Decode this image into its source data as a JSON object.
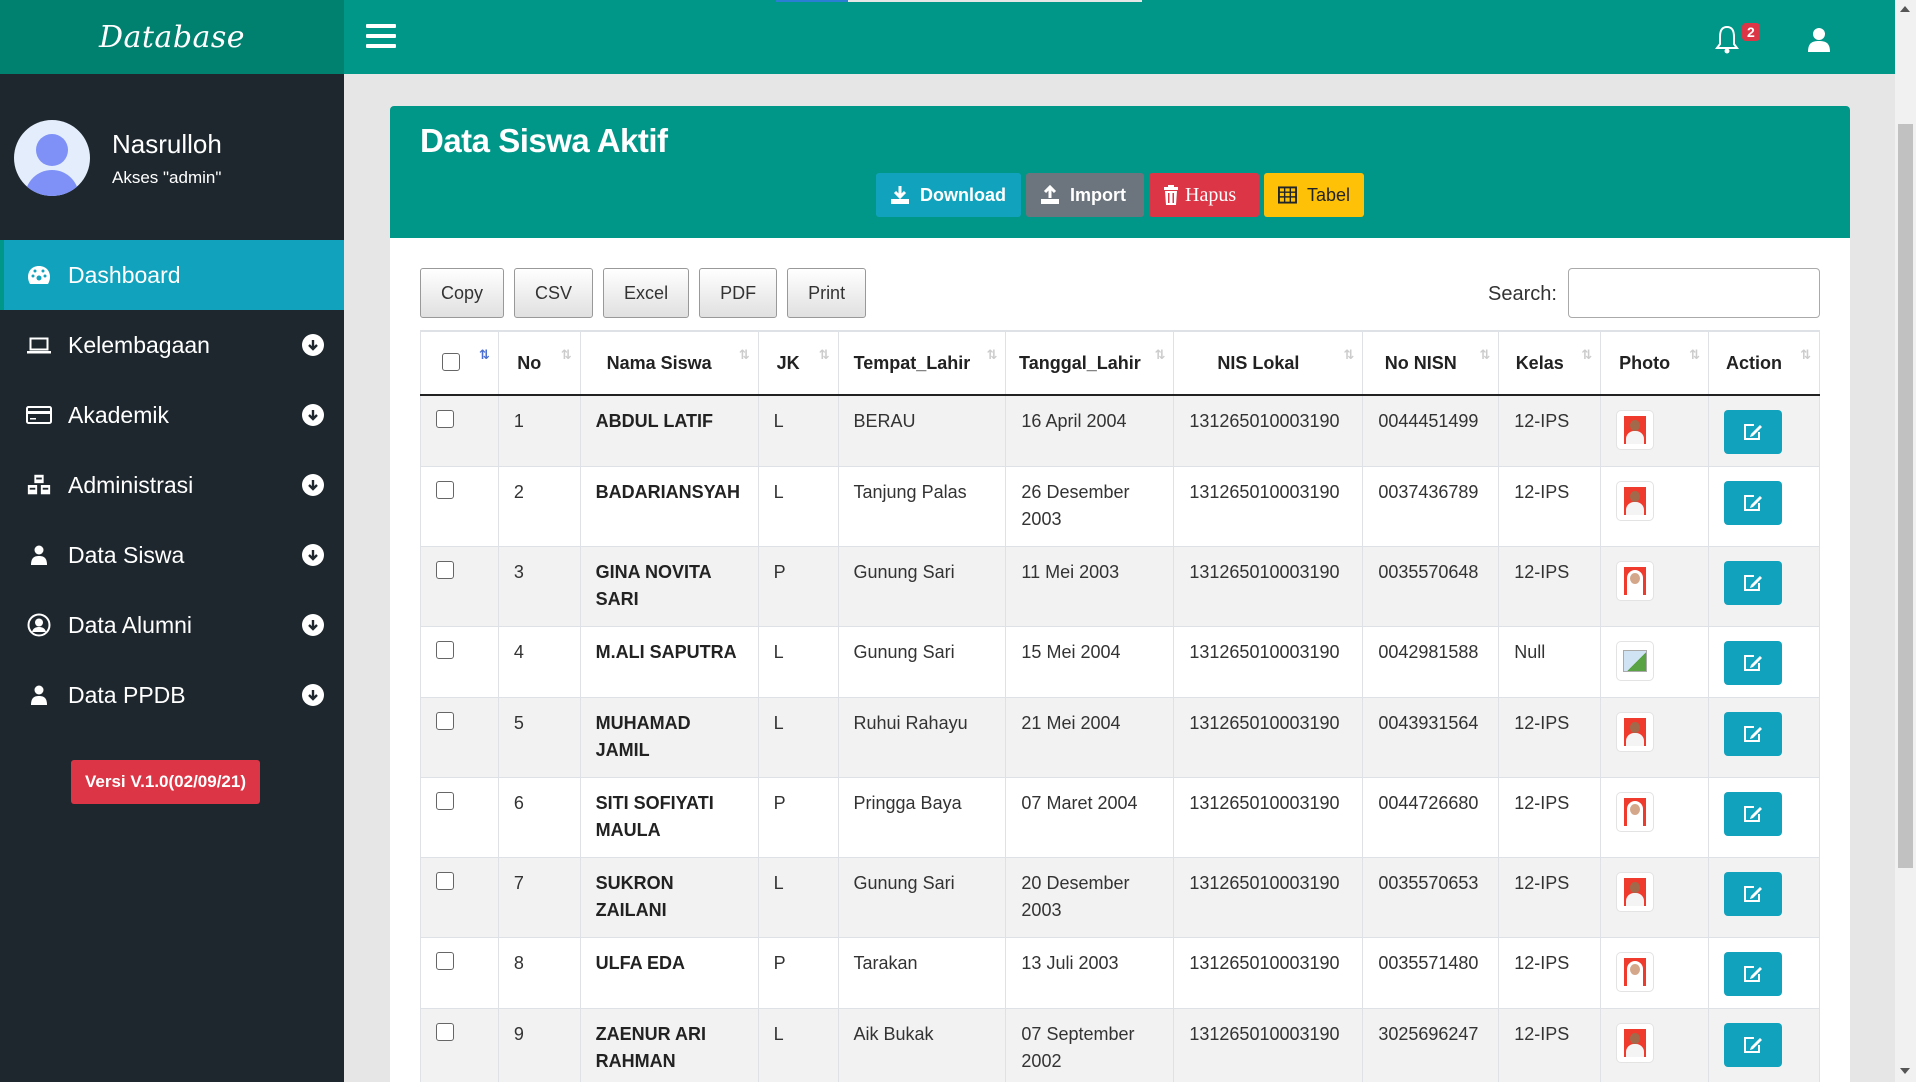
{
  "app": {
    "brand": "Database",
    "notifications_count": "2"
  },
  "colors": {
    "topbar": "#009688",
    "brand_bg": "#00806f",
    "sidebar_bg": "#1e272e",
    "active_item": "#11a3bd",
    "danger": "#dc3545",
    "warning": "#ffc107",
    "secondary": "#6c757d",
    "info": "#11a3bd"
  },
  "user": {
    "name": "Nasrulloh",
    "role": "Akses \"admin\""
  },
  "sidebar": {
    "items": [
      {
        "label": "Dashboard",
        "icon": "tachometer-icon",
        "active": true
      },
      {
        "label": "Kelembagaan",
        "icon": "laptop-icon"
      },
      {
        "label": "Akademik",
        "icon": "credit-card-icon"
      },
      {
        "label": "Administrasi",
        "icon": "cubes-icon"
      },
      {
        "label": "Data Siswa",
        "icon": "user-icon"
      },
      {
        "label": "Data Alumni",
        "icon": "user-circle-icon"
      },
      {
        "label": "Data PPDB",
        "icon": "user-icon"
      }
    ],
    "version": "Versi V.1.0(02/09/21)"
  },
  "page": {
    "title": "Data Siswa Aktif",
    "header_buttons": {
      "download": "Download",
      "import": "Import",
      "hapus": "Hapus",
      "tabel": "Tabel"
    },
    "export_buttons": [
      "Copy",
      "CSV",
      "Excel",
      "PDF",
      "Print"
    ],
    "search": {
      "label": "Search:",
      "value": ""
    }
  },
  "table": {
    "columns": [
      "No",
      "Nama Siswa",
      "JK",
      "Tempat_Lahir",
      "Tanggal_Lahir",
      "NIS Lokal",
      "No NISN",
      "Kelas",
      "Photo",
      "Action"
    ],
    "rows": [
      {
        "no": "1",
        "nama": "ABDUL LATIF",
        "jk": "L",
        "tempat": "BERAU",
        "tanggal": "16 April 2004",
        "nis": "131265010003190",
        "nisn": "0044451499",
        "kelas": "12-IPS",
        "photo": "male"
      },
      {
        "no": "2",
        "nama": "BADARIANSYAH",
        "jk": "L",
        "tempat": "Tanjung Palas",
        "tanggal": "26 Desember 2003",
        "nis": "131265010003190",
        "nisn": "0037436789",
        "kelas": "12-IPS",
        "photo": "male"
      },
      {
        "no": "3",
        "nama": "GINA NOVITA SARI",
        "jk": "P",
        "tempat": "Gunung Sari",
        "tanggal": "11 Mei 2003",
        "nis": "131265010003190",
        "nisn": "0035570648",
        "kelas": "12-IPS",
        "photo": "female"
      },
      {
        "no": "4",
        "nama": "M.ALI SAPUTRA",
        "jk": "L",
        "tempat": "Gunung Sari",
        "tanggal": "15 Mei 2004",
        "nis": "131265010003190",
        "nisn": "0042981588",
        "kelas": "Null",
        "photo": "broken"
      },
      {
        "no": "5",
        "nama": "MUHAMAD JAMIL",
        "jk": "L",
        "tempat": "Ruhui Rahayu",
        "tanggal": "21 Mei 2004",
        "nis": "131265010003190",
        "nisn": "0043931564",
        "kelas": "12-IPS",
        "photo": "male"
      },
      {
        "no": "6",
        "nama": "SITI SOFIYATI MAULA",
        "jk": "P",
        "tempat": "Pringga Baya",
        "tanggal": "07 Maret 2004",
        "nis": "131265010003190",
        "nisn": "0044726680",
        "kelas": "12-IPS",
        "photo": "female"
      },
      {
        "no": "7",
        "nama": "SUKRON ZAILANI",
        "jk": "L",
        "tempat": "Gunung Sari",
        "tanggal": "20 Desember 2003",
        "nis": "131265010003190",
        "nisn": "0035570653",
        "kelas": "12-IPS",
        "photo": "male"
      },
      {
        "no": "8",
        "nama": "ULFA EDA",
        "jk": "P",
        "tempat": "Tarakan",
        "tanggal": "13 Juli 2003",
        "nis": "131265010003190",
        "nisn": "0035571480",
        "kelas": "12-IPS",
        "photo": "female"
      },
      {
        "no": "9",
        "nama": "ZAENUR ARI RAHMAN",
        "jk": "L",
        "tempat": "Aik Bukak",
        "tanggal": "07 September 2002",
        "nis": "131265010003190",
        "nisn": "3025696247",
        "kelas": "12-IPS",
        "photo": "male"
      }
    ]
  }
}
